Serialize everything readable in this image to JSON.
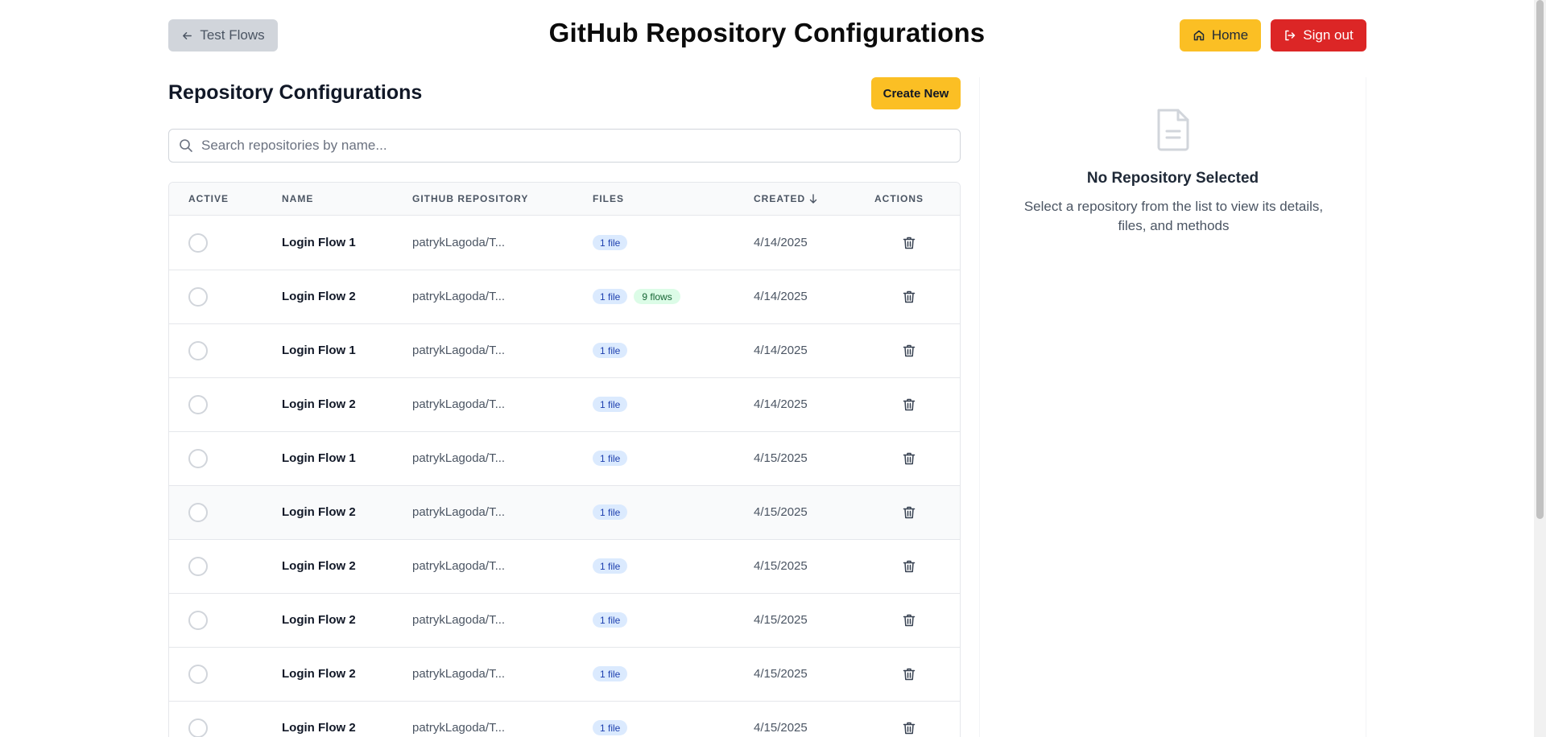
{
  "header": {
    "back_label": "Test Flows",
    "title": "GitHub Repository Configurations",
    "home_label": "Home",
    "signout_label": "Sign out"
  },
  "list": {
    "title": "Repository Configurations",
    "create_label": "Create New",
    "search_placeholder": "Search repositories by name...",
    "search_value": "",
    "columns": {
      "active": "ACTIVE",
      "name": "NAME",
      "repo": "GITHUB REPOSITORY",
      "files": "FILES",
      "created": "CREATED",
      "actions": "ACTIONS"
    },
    "rows": [
      {
        "name": "Login Flow 1",
        "repo": "patrykLagoda/T...",
        "files": "1 file",
        "flows": "",
        "created": "4/14/2025"
      },
      {
        "name": "Login Flow 2",
        "repo": "patrykLagoda/T...",
        "files": "1 file",
        "flows": "9 flows",
        "created": "4/14/2025"
      },
      {
        "name": "Login Flow 1",
        "repo": "patrykLagoda/T...",
        "files": "1 file",
        "flows": "",
        "created": "4/14/2025"
      },
      {
        "name": "Login Flow 2",
        "repo": "patrykLagoda/T...",
        "files": "1 file",
        "flows": "",
        "created": "4/14/2025"
      },
      {
        "name": "Login Flow 1",
        "repo": "patrykLagoda/T...",
        "files": "1 file",
        "flows": "",
        "created": "4/15/2025"
      },
      {
        "name": "Login Flow 2",
        "repo": "patrykLagoda/T...",
        "files": "1 file",
        "flows": "",
        "created": "4/15/2025"
      },
      {
        "name": "Login Flow 2",
        "repo": "patrykLagoda/T...",
        "files": "1 file",
        "flows": "",
        "created": "4/15/2025"
      },
      {
        "name": "Login Flow 2",
        "repo": "patrykLagoda/T...",
        "files": "1 file",
        "flows": "",
        "created": "4/15/2025"
      },
      {
        "name": "Login Flow 2",
        "repo": "patrykLagoda/T...",
        "files": "1 file",
        "flows": "",
        "created": "4/15/2025"
      },
      {
        "name": "Login Flow 2",
        "repo": "patrykLagoda/T...",
        "files": "1 file",
        "flows": "",
        "created": "4/15/2025"
      }
    ]
  },
  "detail": {
    "empty_title": "No Repository Selected",
    "empty_description": "Select a repository from the list to view its details, files, and methods"
  },
  "colors": {
    "accent_yellow": "#fbbf24",
    "danger_red": "#dc2626",
    "file_badge_bg": "#dbeafe",
    "flow_badge_bg": "#dcfce7"
  },
  "icons": {
    "back": "arrow-left-icon",
    "home": "home-icon",
    "signout": "sign-out-icon",
    "search": "search-icon",
    "sort": "arrow-down-icon",
    "delete": "trash-icon",
    "empty": "document-icon"
  }
}
